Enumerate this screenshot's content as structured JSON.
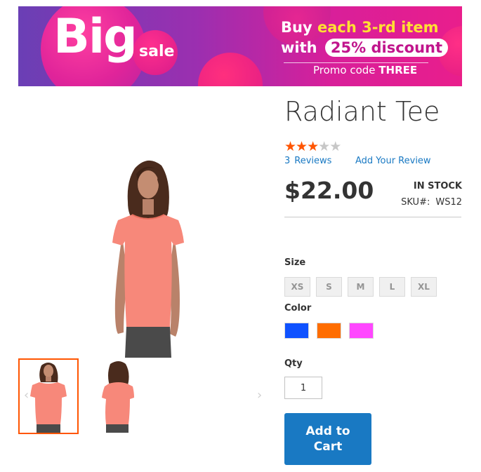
{
  "banner": {
    "big": "Big",
    "sale": "sale",
    "line1_prefix": "Buy ",
    "line1_highlight": "each 3-rd item",
    "line2_prefix": "with ",
    "line2_pill": "25% discount",
    "line3_prefix": "Promo code ",
    "line3_code": "THREE",
    "colors": {
      "highlight": "#ffe033",
      "gradient_start": "#6a3fb5",
      "gradient_end": "#e91e8c"
    }
  },
  "gallery": {
    "prev_arrow": "‹",
    "next_arrow": "›",
    "shirt_color": "#f7887a",
    "active_border": "#ff5501"
  },
  "product": {
    "name": "Radiant Tee",
    "rating": {
      "value": 3,
      "max": 5,
      "star_on": "★",
      "star_off": "★"
    },
    "reviews_count": "3",
    "reviews_label": "Reviews",
    "add_review": "Add Your Review",
    "price": "$22.00",
    "stock": "In stock",
    "sku_label": "SKU#:",
    "sku": "WS12"
  },
  "options": {
    "size_label": "Size",
    "sizes": [
      "XS",
      "S",
      "M",
      "L",
      "XL"
    ],
    "color_label": "Color",
    "colors": [
      "#0f52ff",
      "#ff6d00",
      "#ff47ff"
    ]
  },
  "qty": {
    "label": "Qty",
    "value": "1"
  },
  "cart": {
    "add_label": "Add to Cart",
    "button_color": "#1979c3"
  }
}
